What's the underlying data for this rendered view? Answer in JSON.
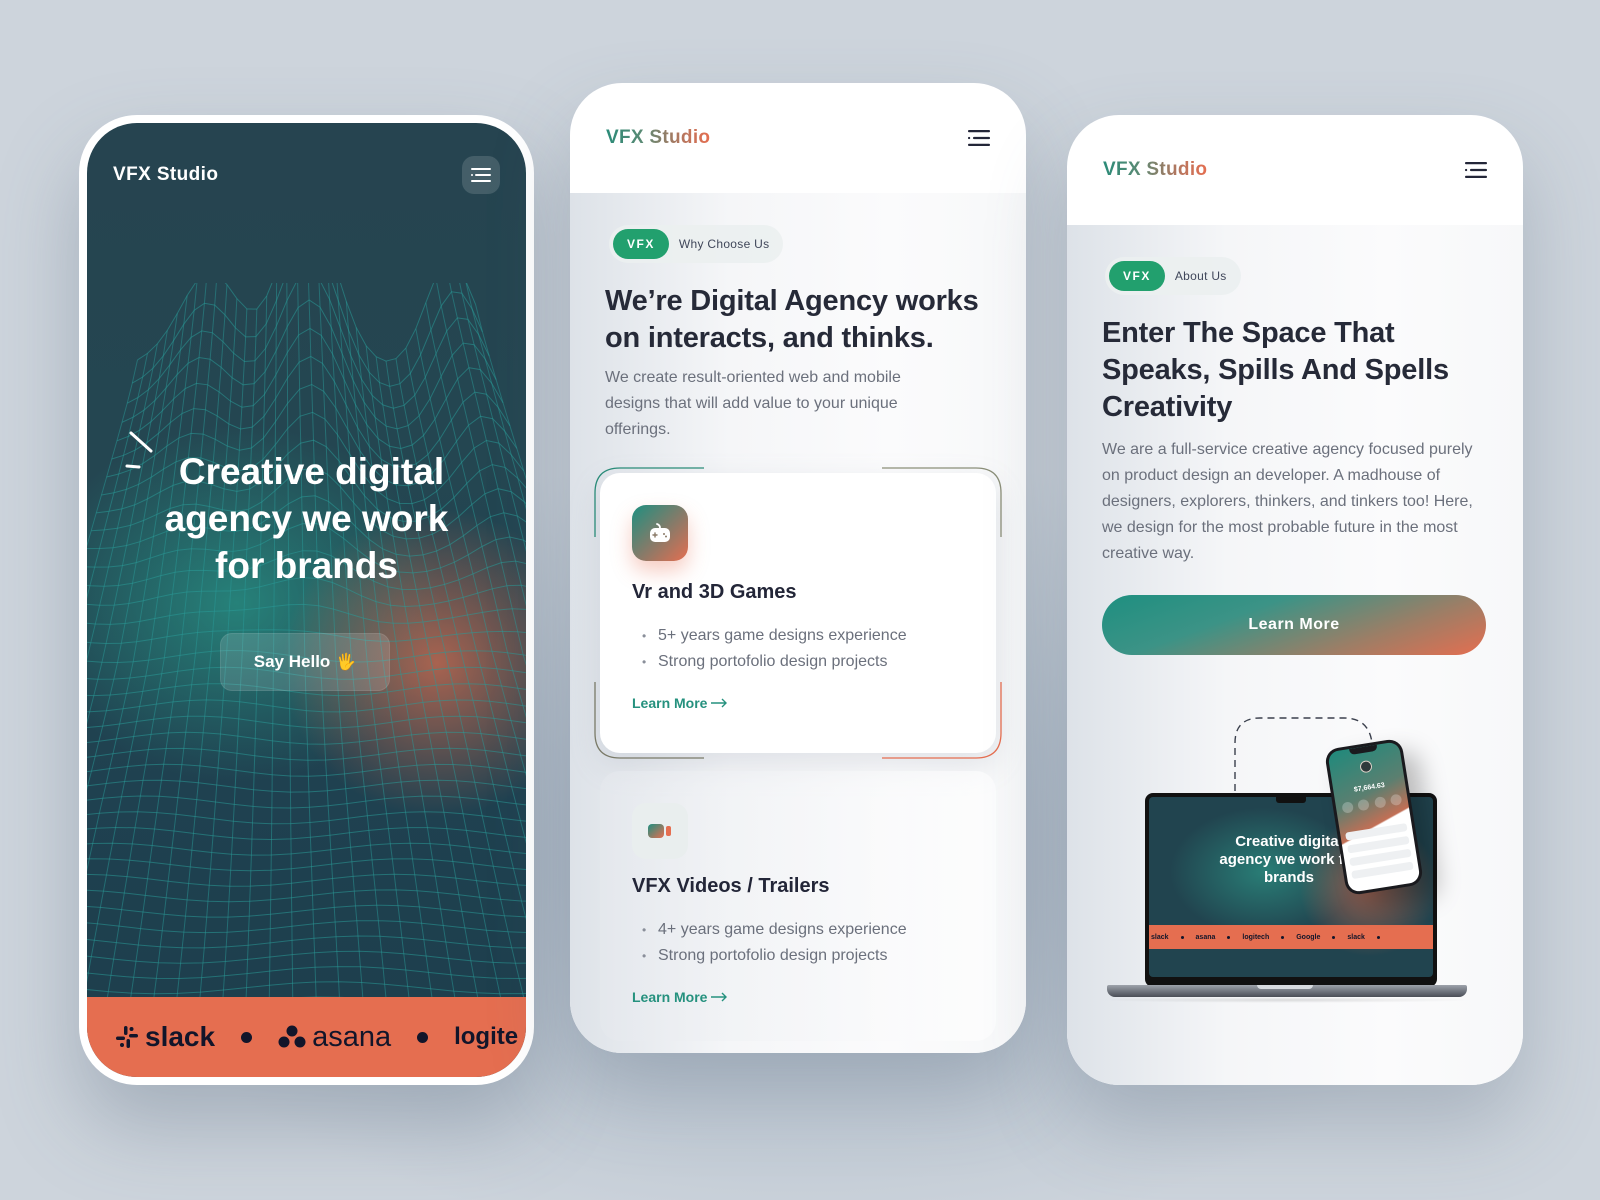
{
  "brand": {
    "name": "VFX Studio",
    "colors": {
      "teal": "#1e8f80",
      "orange": "#e56e50",
      "green_tag": "#22a06e",
      "dark_bg": "#244651",
      "ink": "#262a38"
    }
  },
  "screen1": {
    "logo": "VFX Studio",
    "menu_icon": "menu-icon",
    "hero_title_lines": [
      "Creative digital",
      "agency we work",
      "for brands"
    ],
    "hero_button": "Say Hello",
    "hero_button_emoji": "🖐",
    "brands": [
      "slack",
      "asana",
      "logitech"
    ],
    "brand_visible_partial": "logite"
  },
  "screen2": {
    "logo": "VFX Studio",
    "tag": "VFX",
    "section_label": "Why Choose Us",
    "title": "We’re Digital Agency works on interacts, and thinks.",
    "description": "We create result-oriented web and mobile designs that will add value to your unique offerings.",
    "services": [
      {
        "icon": "gamepad-icon",
        "title": "Vr and 3D Games",
        "points": [
          "5+ years game designs experience",
          "Strong portofolio design projects"
        ],
        "link": "Learn More"
      },
      {
        "icon": "video-camera-icon",
        "title": "VFX Videos / Trailers",
        "points": [
          "4+ years game designs experience",
          "Strong portofolio design projects"
        ],
        "link": "Learn More"
      }
    ]
  },
  "screen3": {
    "logo": "VFX Studio",
    "tag": "VFX",
    "section_label": "About Us",
    "title": "Enter The Space That Speaks, Spills And Spells Creativity",
    "description": "We are a full-service creative agency focused purely on product design an developer. A madhouse of designers, explorers, thinkers, and tinkers too! Here, we design for the most probable future in the most creative way.",
    "cta": "Learn More",
    "mockup": {
      "laptop_title": "Creative digital agency we work for brands",
      "laptop_brands": [
        "slack",
        "asana",
        "logitech",
        "Google",
        "slack"
      ],
      "phone_balance": "$7,664.63"
    }
  }
}
